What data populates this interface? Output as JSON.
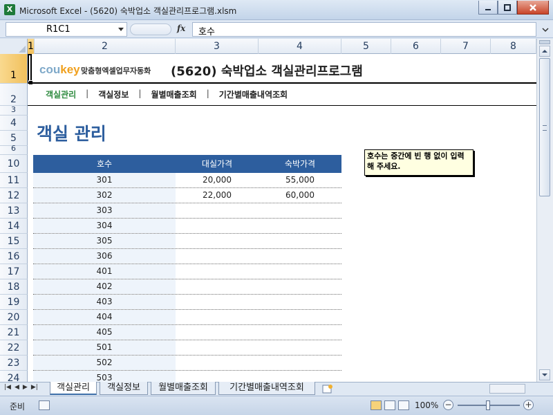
{
  "window": {
    "title": "Microsoft Excel - (5620) 숙박업소 객실관리프로그램.xlsm",
    "app_icon": "X"
  },
  "formula_bar": {
    "cell_ref": "R1C1",
    "fx": "fx",
    "value": "호수"
  },
  "columns": [
    "1",
    "2",
    "3",
    "4",
    "5",
    "6",
    "7",
    "8"
  ],
  "rows": [
    "1",
    "2",
    "3",
    "4",
    "5",
    "6",
    "10",
    "11",
    "12",
    "13",
    "14",
    "15",
    "16",
    "17",
    "18",
    "19",
    "20",
    "21",
    "22",
    "23",
    "24"
  ],
  "sheet": {
    "logo_main": "cou",
    "logo_key": "key",
    "logo_sub": "맞춤형엑셀업무자동화",
    "program_title": "(5620) 숙박업소 객실관리프로그램",
    "nav": [
      "객실관리",
      "객실정보",
      "월별매출조회",
      "기간별매출내역조회"
    ],
    "nav_sep": "|",
    "page_title": "객실 관리",
    "table_headers": [
      "호수",
      "대실가격",
      "숙박가격"
    ],
    "table_rows": [
      [
        "301",
        "20,000",
        "55,000"
      ],
      [
        "302",
        "22,000",
        "60,000"
      ],
      [
        "303",
        "",
        ""
      ],
      [
        "304",
        "",
        ""
      ],
      [
        "305",
        "",
        ""
      ],
      [
        "306",
        "",
        ""
      ],
      [
        "401",
        "",
        ""
      ],
      [
        "402",
        "",
        ""
      ],
      [
        "403",
        "",
        ""
      ],
      [
        "404",
        "",
        ""
      ],
      [
        "405",
        "",
        ""
      ],
      [
        "501",
        "",
        ""
      ],
      [
        "502",
        "",
        ""
      ],
      [
        "503",
        "",
        ""
      ]
    ],
    "note": "호수는 중간에 빈 행 없이 입력해 주세요."
  },
  "tabs": [
    "객실관리",
    "객실정보",
    "월별매출조회",
    "기간별매출내역조회"
  ],
  "tab_nav": [
    "|◀",
    "◀",
    "▶",
    "▶|"
  ],
  "status": {
    "ready": "준비",
    "zoom": "100%",
    "minus": "−",
    "plus": "+"
  },
  "colors": {
    "accent": "#2d5e9e",
    "nav_active": "#2d8a3e",
    "logo_key": "#f0a01e"
  }
}
